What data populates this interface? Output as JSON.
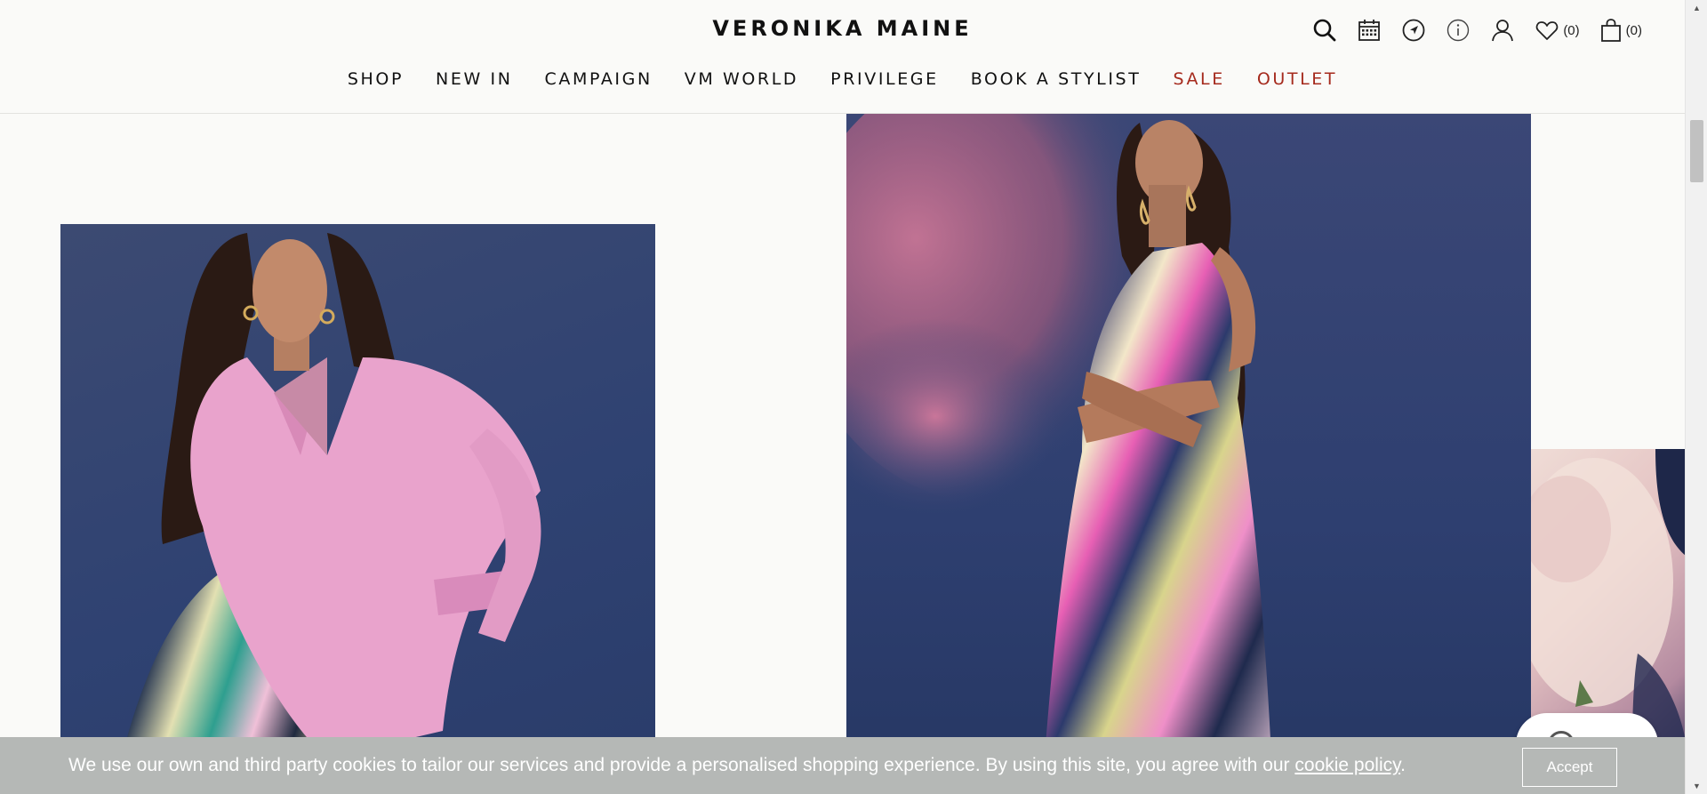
{
  "header": {
    "logo": "VERONIKA MAINE",
    "wishlist_count": "(0)",
    "cart_count": "(0)",
    "icons": [
      "search-icon",
      "calendar-icon",
      "location-icon",
      "info-icon",
      "account-icon",
      "heart-icon",
      "bag-icon"
    ]
  },
  "nav": {
    "items": [
      {
        "label": "SHOP",
        "color": "#111111"
      },
      {
        "label": "NEW IN",
        "color": "#111111"
      },
      {
        "label": "CAMPAIGN",
        "color": "#111111"
      },
      {
        "label": "VM WORLD",
        "color": "#111111"
      },
      {
        "label": "PRIVILEGE",
        "color": "#111111"
      },
      {
        "label": "BOOK A STYLIST",
        "color": "#111111"
      },
      {
        "label": "SALE",
        "color": "#a52a1d"
      },
      {
        "label": "OUTLET",
        "color": "#a52a1d"
      }
    ]
  },
  "cookie": {
    "message": "We use our own and third party cookies to tailor our services and provide a personalised shopping experience. By using this site, you agree with our ",
    "link": "cookie policy",
    "after": ".",
    "accept_label": "Accept"
  },
  "colors": {
    "background": "#fafaf8",
    "accent_red": "#a52a1d",
    "photo_blue": "#2e3f70",
    "cookie_bar": "#b5b8b6"
  }
}
